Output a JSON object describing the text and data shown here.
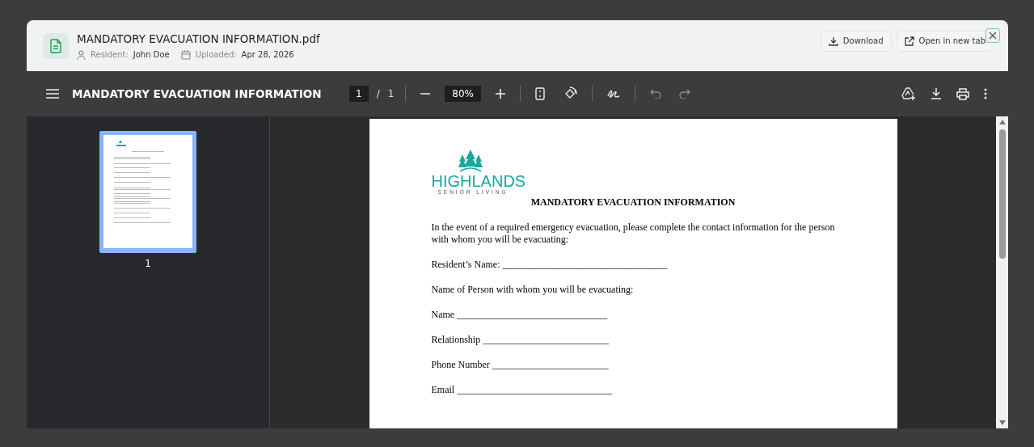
{
  "dialog": {
    "file_name": "MANDATORY EVACUATION INFORMATION.pdf",
    "meta": [
      {
        "kind": "person",
        "label": "Resident:",
        "value": "John Doe"
      },
      {
        "kind": "calendar",
        "label": "Uploaded:",
        "value": "Apr 28, 2026"
      }
    ],
    "actions": [
      {
        "kind": "download",
        "label": "Download"
      },
      {
        "kind": "external",
        "label": "Open in new tab"
      }
    ]
  },
  "viewer": {
    "title": "MANDATORY EVACUATION INFORMATION",
    "page": "1",
    "page_sep": "/",
    "page_count": "1",
    "zoom": "80%",
    "undo": {
      "disabled": true
    },
    "redo": {
      "disabled": true
    },
    "thumbnails": [
      {
        "label": "1",
        "selected": true
      }
    ]
  },
  "document": {
    "logo": {
      "name": "HIGHLANDS",
      "tagline": "SENIOR LIVING"
    },
    "heading": "MANDATORY EVACUATION INFORMATION",
    "paragraphs": [
      "In the event of a required emergency evacuation, please complete the contact information for the person with whom you will be evacuating:",
      "Resident’s Name: __________________________________",
      "Name of Person with whom you will be evacuating:",
      "Name _______________________________",
      "Relationship __________________________",
      "Phone Number ________________________",
      "Email ________________________________"
    ]
  }
}
